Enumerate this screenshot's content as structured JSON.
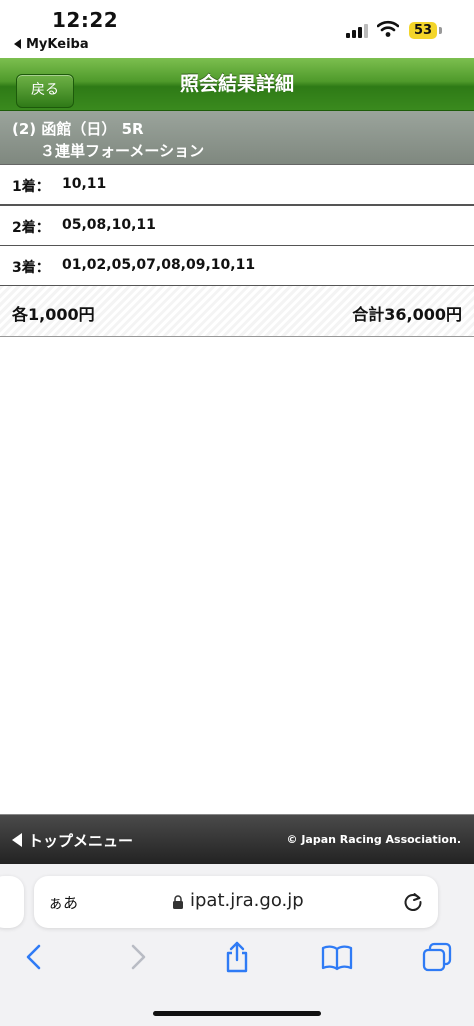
{
  "status_bar": {
    "time": "12:22",
    "back_app": "MyKeiba",
    "battery": "53"
  },
  "header": {
    "back_label": "戻る",
    "title": "照会結果詳細"
  },
  "race": {
    "line1": "(2) 函館（日） 5R",
    "line2": "３連単フォーメーション"
  },
  "rows": [
    {
      "label": "1着：",
      "value": "10,11"
    },
    {
      "label": "2着：",
      "value": "05,08,10,11"
    },
    {
      "label": "3着：",
      "value": "01,02,05,07,08,09,10,11"
    }
  ],
  "totals": {
    "each": "各1,000円",
    "sum": "合計36,000円"
  },
  "footer": {
    "top_menu": "トップメニュー",
    "copyright": "© Japan Racing Association."
  },
  "browser": {
    "aa_label": "ぁあ",
    "url": "ipat.jra.go.jp"
  },
  "colors": {
    "header_green": "#3a8a1e",
    "race_gray": "#8a938a",
    "footer_dark": "#2e2e2e",
    "ios_blue": "#2f7bf5",
    "battery_yellow": "#f3d52a"
  }
}
